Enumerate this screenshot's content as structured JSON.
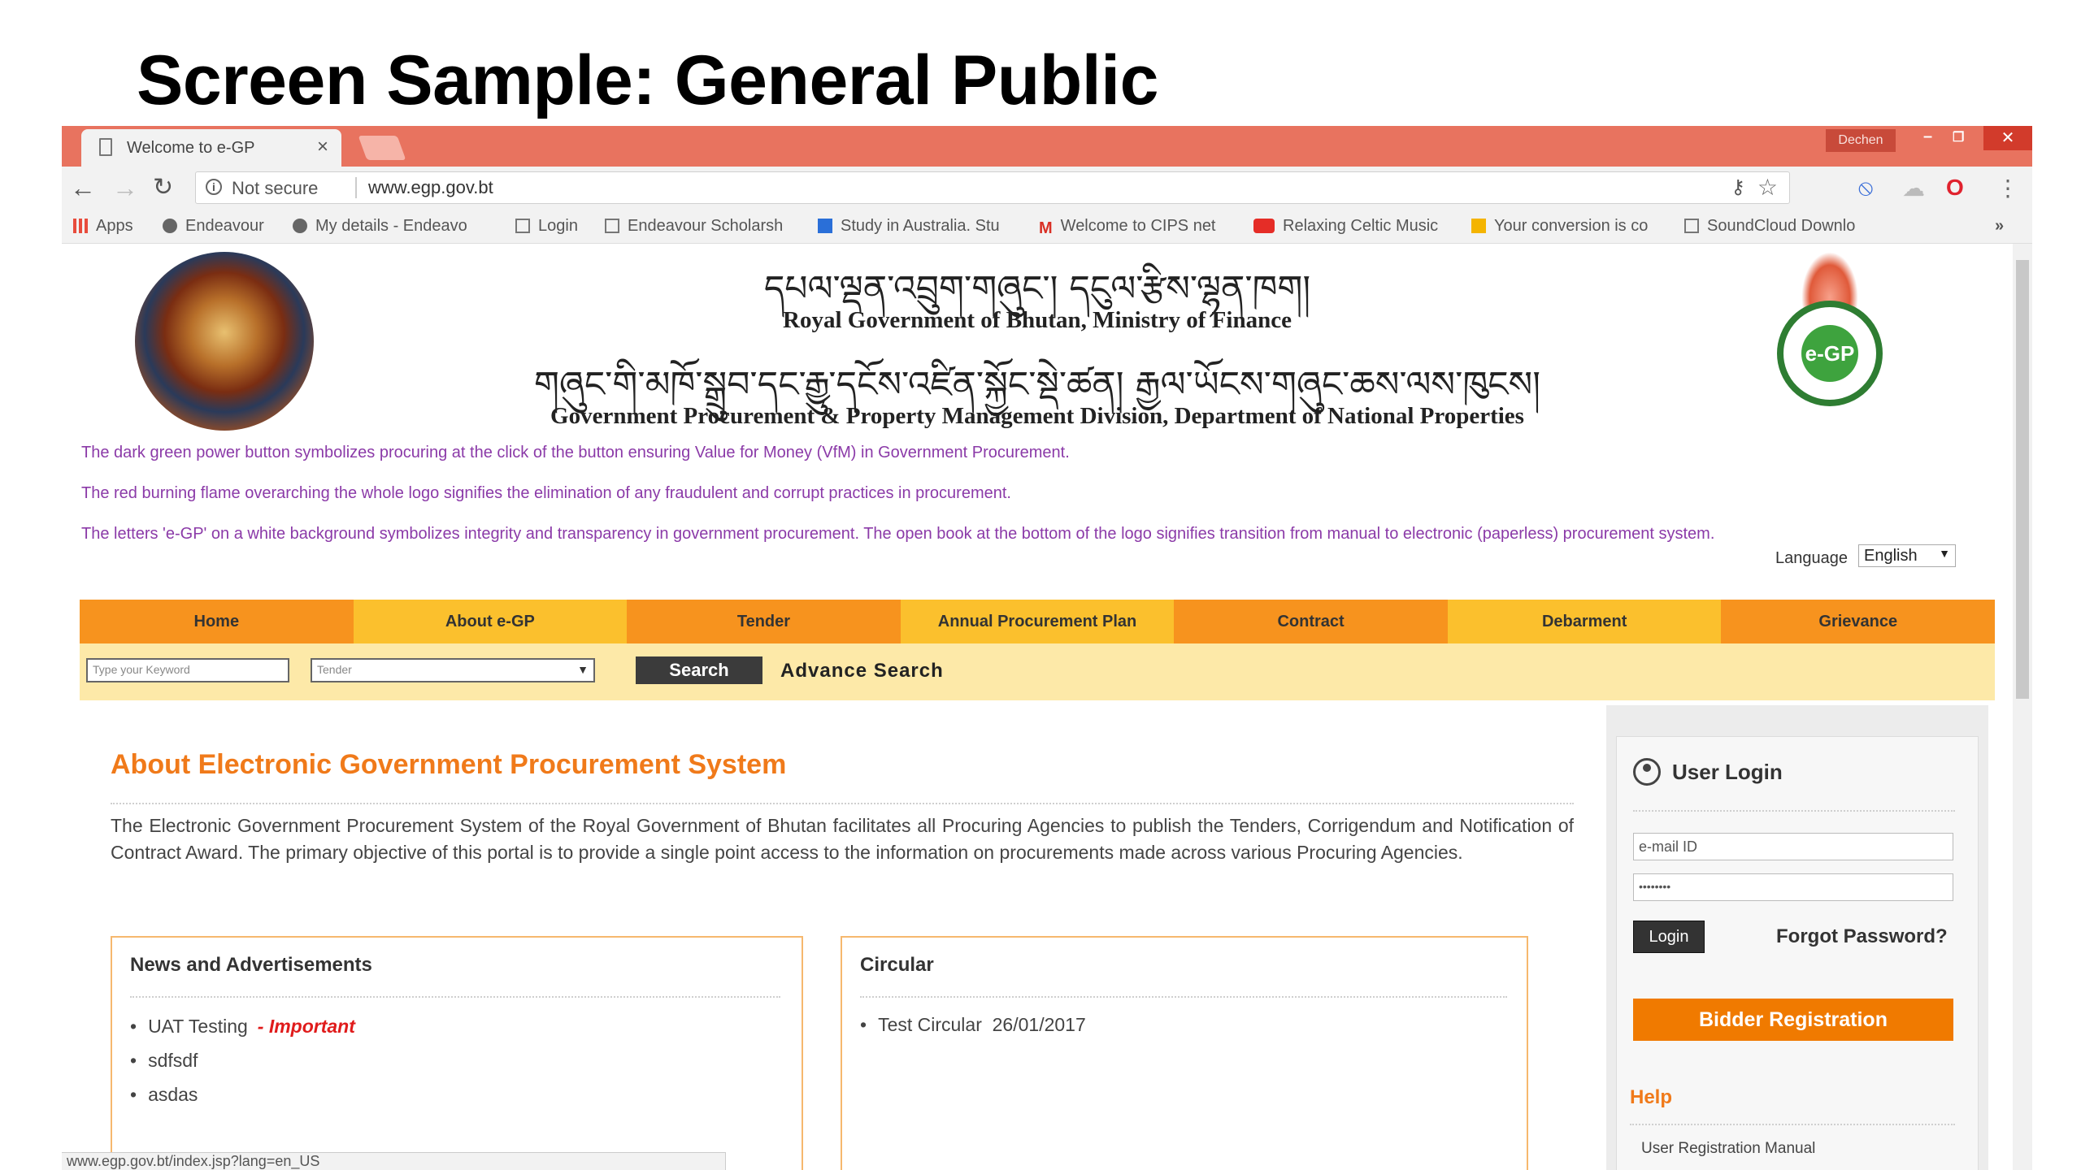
{
  "slide": {
    "title": "Screen Sample: General Public"
  },
  "browser": {
    "tab_title": "Welcome to e-GP",
    "user_name": "Dechen",
    "not_secure": "Not secure",
    "url": "www.egp.gov.bt",
    "bookmarks": [
      "Apps",
      "Endeavour",
      "My details - Endeavo",
      "Login",
      "Endeavour Scholarsh",
      "Study in Australia. Stu",
      "Welcome to CIPS net",
      "Relaxing Celtic Music",
      "Your conversion is co",
      "SoundCloud Downlo"
    ],
    "bookmarks_more": "»",
    "status_url": "www.egp.gov.bt/index.jsp?lang=en_US"
  },
  "header": {
    "dz_line1": "དཔལ་ལྡན་འབྲུག་གཞུང་། དངུལ་རྩིས་ལྷན་ཁག།",
    "en_line1": "Royal Government of Bhutan, Ministry of Finance",
    "dz_line2": "གཞུང་གི་མཁོ་སྒྲུབ་དང་རྒྱུ་དངོས་འཛིན་སྐྱོང་སྡེ་ཚན། རྒྱལ་ཡོངས་གཞུང་ཆས་ལས་ཁུངས།",
    "en_line2": "Government Procurement & Property Management Division, Department of National Properties",
    "logo_text": "e-GP"
  },
  "notes": [
    "The dark green power button symbolizes procuring at the click of the button ensuring Value for Money (VfM) in Government Procurement.",
    "The red burning flame overarching the whole logo signifies the elimination of any fraudulent and corrupt practices in procurement.",
    "The letters 'e-GP' on a white background symbolizes integrity and transparency in government procurement. The open book at the bottom of the logo signifies transition from manual to electronic (paperless) procurement system."
  ],
  "language": {
    "label": "Language",
    "value": "English"
  },
  "menu": [
    "Home",
    "About e-GP",
    "Tender",
    "Annual Procurement Plan",
    "Contract",
    "Debarment",
    "Grievance"
  ],
  "search": {
    "keyword_placeholder": "Type your Keyword",
    "type_value": "Tender",
    "button": "Search",
    "advance": "Advance Search"
  },
  "about": {
    "title": "About Electronic Government Procurement System",
    "text": "The Electronic Government Procurement System of the Royal Government of Bhutan facilitates all Procuring Agencies to publish the Tenders, Corrigendum and Notification of Contract Award. The primary objective of this portal is to provide a single point access to the information on procurements made across various Procuring Agencies."
  },
  "news": {
    "title": "News and Advertisements",
    "items": [
      "UAT Testing",
      "sdfsdf",
      "asdas"
    ],
    "important": "- Important"
  },
  "circular": {
    "title": "Circular",
    "items": [
      "Test Circular  26/01/2017"
    ]
  },
  "login": {
    "heading": "User Login",
    "email_placeholder": "e-mail ID",
    "password_mask": "••••••••",
    "login_button": "Login",
    "forgot": "Forgot Password?",
    "bidder_button": "Bidder Registration",
    "help_title": "Help",
    "manual": "User Registration Manual"
  }
}
